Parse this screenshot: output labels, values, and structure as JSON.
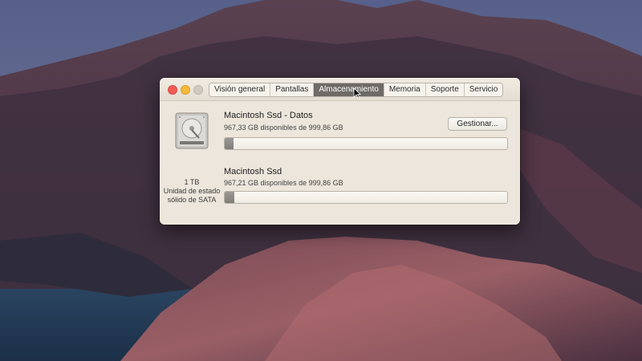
{
  "window": {
    "tabs": [
      "Visión general",
      "Pantallas",
      "Almacenamiento",
      "Memoria",
      "Soporte",
      "Servicio"
    ],
    "active_tab": "Almacenamiento"
  },
  "disk": {
    "capacity": "1 TB",
    "type_line1": "Unidad de estado",
    "type_line2": "sólido de SATA"
  },
  "volumes": [
    {
      "name": "Macintosh Ssd - Datos",
      "info": "967,33 GB disponibles de 999,86 GB",
      "used_fraction": 0.0325
    },
    {
      "name": "Macintosh Ssd",
      "info": "967,21 GB disponibles de 999,86 GB",
      "used_fraction": 0.0327
    }
  ],
  "buttons": {
    "manage": "Gestionar..."
  },
  "colors": {
    "close": "#ef5d55",
    "minimize": "#f4b93b",
    "zoom_disabled": "#cfcac2",
    "active_tab": "#6e6a66"
  },
  "icons": [
    "close-icon",
    "minimize-icon",
    "zoom-icon",
    "hard-disk-icon",
    "pointer-cursor-icon"
  ]
}
